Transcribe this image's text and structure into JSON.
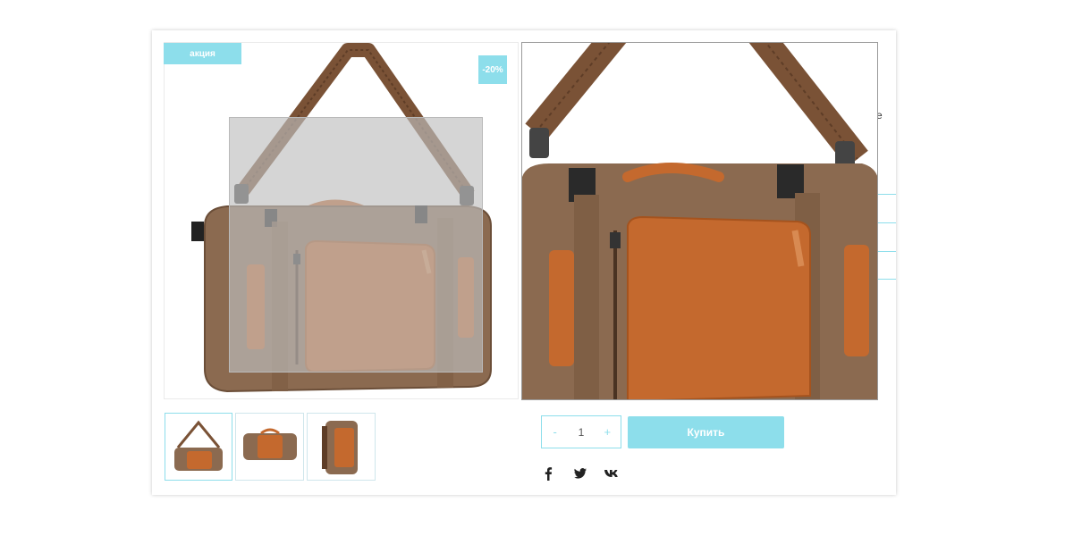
{
  "badges": {
    "sale": "акция",
    "discount": "-20%"
  },
  "quantity": {
    "decrement": "-",
    "value": "1",
    "increment": "+"
  },
  "buy_button": "Купить",
  "peek_text": "e",
  "social": [
    {
      "icon": "facebook-icon"
    },
    {
      "icon": "twitter-icon"
    },
    {
      "icon": "vk-icon"
    }
  ],
  "thumbnails": [
    {
      "view": "bag-with-strap",
      "active": true
    },
    {
      "view": "bag-front",
      "active": false
    },
    {
      "view": "bag-backpack",
      "active": false
    }
  ],
  "colors": {
    "accent": "#8ddeeb",
    "canvas_body": "#8b6a50",
    "leather": "#c4692e"
  }
}
